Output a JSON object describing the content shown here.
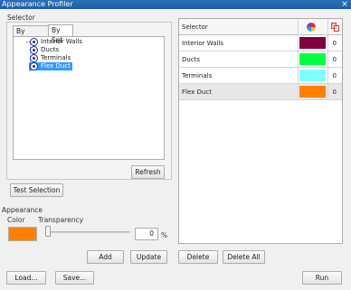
{
  "window": {
    "title": "Appearance Profiler",
    "close_glyph": "×"
  },
  "selector_group": {
    "label": "Selector"
  },
  "tabs": [
    {
      "label": "By Property",
      "active": false
    },
    {
      "label": "By Set",
      "active": true
    }
  ],
  "tree": {
    "items": [
      {
        "label": "Interior Walls",
        "selected": false
      },
      {
        "label": "Ducts",
        "selected": false
      },
      {
        "label": "Terminals",
        "selected": false
      },
      {
        "label": "Flex Duct",
        "selected": true
      }
    ]
  },
  "buttons": {
    "refresh": "Refresh",
    "test_selection": "Test Selection",
    "add": "Add",
    "update": "Update",
    "delete": "Delete",
    "delete_all": "Delete All",
    "load": "Load...",
    "save": "Save...",
    "run": "Run"
  },
  "appearance": {
    "label": "Appearance",
    "color_label": "Color",
    "color": "#ff8000",
    "transparency_label": "Transparency",
    "transparency_value": "0",
    "unit": "%"
  },
  "grid": {
    "header": {
      "selector": "Selector",
      "color_icon": "palette-icon",
      "transparency_icon": "transparency-icon"
    },
    "rows": [
      {
        "name": "Interior Walls",
        "color": "#800040",
        "transparency": "0"
      },
      {
        "name": "Ducts",
        "color": "#00ff40",
        "transparency": "0"
      },
      {
        "name": "Terminals",
        "color": "#80ffff",
        "transparency": "0"
      },
      {
        "name": "Flex Duct",
        "color": "#ff8000",
        "transparency": "0"
      }
    ]
  }
}
